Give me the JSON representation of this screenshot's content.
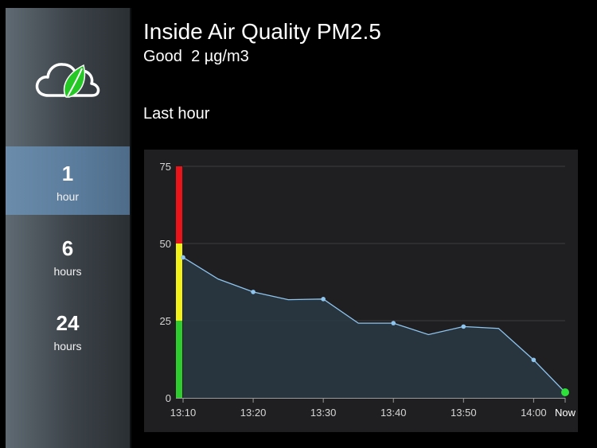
{
  "header": {
    "title": "Inside Air Quality PM2.5",
    "status": "Good",
    "value": "2 µg/m3"
  },
  "period_label": "Last hour",
  "sidebar": {
    "logo_icon": "cloud-leaf-icon",
    "ranges": [
      {
        "num": "1",
        "unit": "hour",
        "active": true
      },
      {
        "num": "6",
        "unit": "hours",
        "active": false
      },
      {
        "num": "24",
        "unit": "hours",
        "active": false
      }
    ]
  },
  "colors": {
    "accent_line": "#8ec5ef",
    "band_red": "#e8141a",
    "band_yellow": "#f2f21a",
    "band_green": "#2ecc2e",
    "current_point": "#2ee03a",
    "active_tab": "#5f809f"
  },
  "chart_data": {
    "type": "area",
    "y_ticks": [
      "75",
      "50",
      "25",
      "0"
    ],
    "ylim": [
      0,
      75
    ],
    "x_tick_labels": [
      "13:10",
      "13:20",
      "13:30",
      "13:40",
      "13:50",
      "14:00",
      "Now"
    ],
    "x_ticks": [
      0,
      10,
      20,
      30,
      40,
      50,
      54.5
    ],
    "xlim": [
      0,
      54.5
    ],
    "grid": true,
    "bands": [
      {
        "from": 0,
        "to": 25,
        "color": "green"
      },
      {
        "from": 25,
        "to": 50,
        "color": "yellow"
      },
      {
        "from": 50,
        "to": 75,
        "color": "red"
      }
    ],
    "series": [
      {
        "x": [
          0,
          5,
          10,
          15,
          20,
          25,
          30,
          35,
          40,
          45,
          50,
          54.5
        ],
        "values": [
          45.5,
          38.5,
          34.3,
          31.8,
          32.0,
          24.2,
          24.2,
          20.5,
          23.1,
          22.5,
          12.3,
          1.8
        ]
      }
    ],
    "marked_points": [
      0,
      2,
      4,
      6,
      8,
      10
    ],
    "current_index": 11
  }
}
